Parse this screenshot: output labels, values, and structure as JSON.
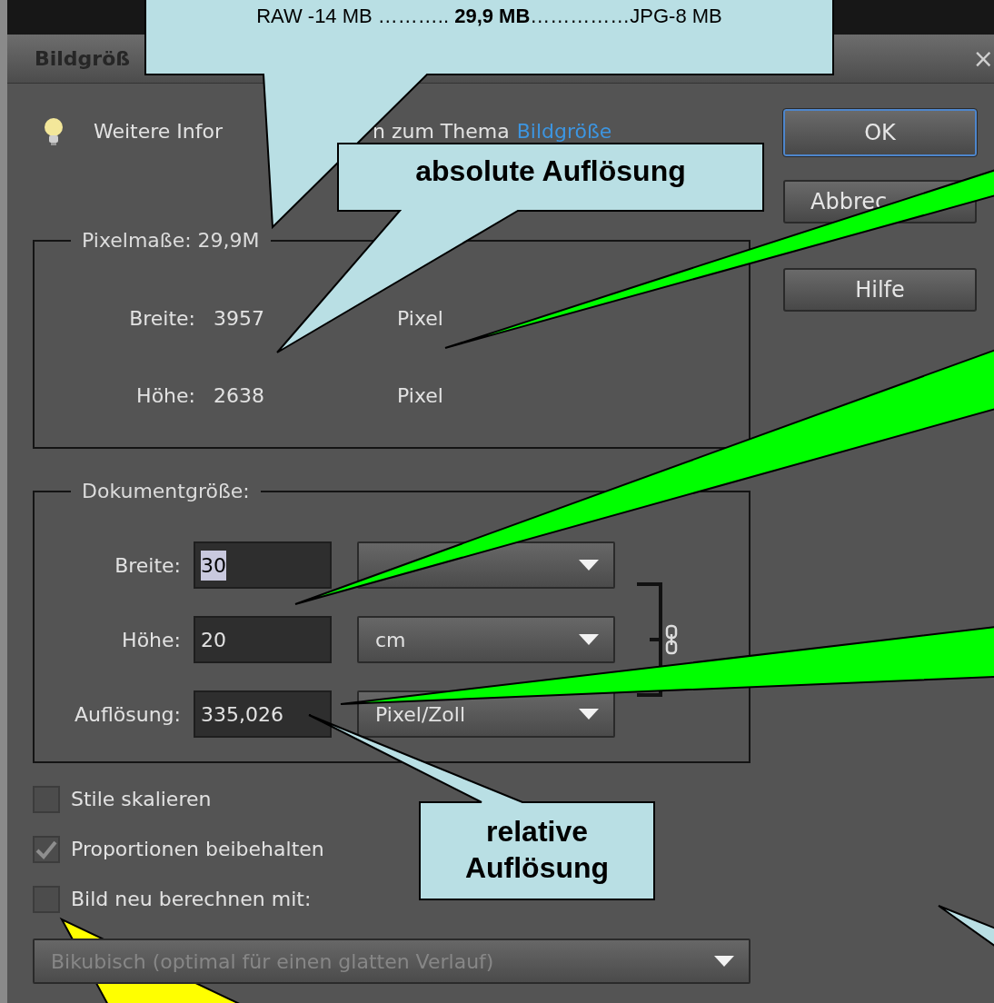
{
  "window": {
    "title": "Bildgröß",
    "close": "×"
  },
  "info": {
    "text_1": "Weitere Infor",
    "text_2": "n zum Thema",
    "link": "Bildgröße"
  },
  "buttons": [
    {
      "label": "OK",
      "default": true
    },
    {
      "label": "Abbrec",
      "default": false
    },
    {
      "label": "Hilfe",
      "default": false
    }
  ],
  "pixel_dimensions": {
    "legend": "Pixelmaße: 29,9M",
    "rows": [
      {
        "label": "Breite:",
        "value": "3957",
        "unit": "Pixel"
      },
      {
        "label": "Höhe:",
        "value": "2638",
        "unit": "Pixel"
      }
    ]
  },
  "document_size": {
    "legend": "Dokumentgröße:",
    "rows": [
      {
        "label": "Breite:",
        "value": "30",
        "value_selected": true
      },
      {
        "label": "Höhe:",
        "value": "20",
        "value_selected": false,
        "unit": "cm"
      },
      {
        "label": "Auflösung:",
        "value": "335,026",
        "value_selected": false,
        "unit": "Pixel/Zoll"
      }
    ]
  },
  "options": [
    {
      "label": "Stile skalieren",
      "checked": false
    },
    {
      "label": "Proportionen beibehalten",
      "checked": true
    },
    {
      "label": "Bild neu berechnen mit:",
      "checked": false
    }
  ],
  "resample": {
    "value": "Bikubisch (optimal für einen glatten Verlauf)",
    "disabled": true
  },
  "callouts": [
    {
      "text": "RAW -14 MB ……….. **29,9 MB**……………JPG-8 MB",
      "kind": "plain"
    },
    {
      "text": "absolute Auflösung",
      "kind": "bold"
    },
    {
      "text": "relative Auflösung",
      "kind": "bold"
    }
  ]
}
